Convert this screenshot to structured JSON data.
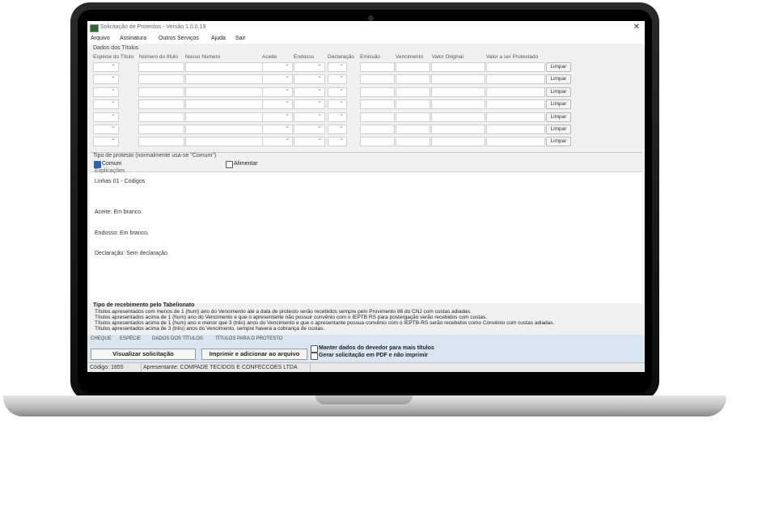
{
  "window": {
    "title": "Solicitação de Protestos - Versão 1.0.0.19"
  },
  "menu": [
    "Arquivo",
    "Assinatura",
    "Outros Serviços",
    "Ajuda",
    "Sair"
  ],
  "titles_section": {
    "label": "Dados dos Títulos",
    "columns": [
      "Espécie do Título",
      "Número do título",
      "Nosso Número",
      "Aceite",
      "Endosso",
      "Declaração",
      "Emissão",
      "Vencimento",
      "Valor Original",
      "Valor a ser Protestado"
    ],
    "row_button": "Limpar",
    "row_count": 7
  },
  "protest_type": {
    "label": "Tipo de protesto (normalmente usa-se \"Comum\")",
    "option_comum": "Comum",
    "option_alimentar": "Alimentar"
  },
  "explanation": {
    "label": "Explicações",
    "lines": [
      "Linhas 01 - Códigos",
      "Aceite: Em branco.",
      "Endosso: Em branco.",
      "Declaração: Sem declaração."
    ]
  },
  "receipt": {
    "label": "Tipo de recebimento pelo Tabelionato",
    "lines": [
      "Títulos apresentados com menos de 1 (hum) ano do Vencimento até a data de protesto serão recebidos sempre pelo Provimento 86 do CNJ com custas adiadas.",
      "Títulos apresentados acima de 1 (hum) ano do Vencimento e que o apresentante não possuir convênio com o IEPTB RS para postergação serão recebidos com custas.",
      "Títulos apresentados acima de 1 (hum) ano e menor que 3 (três) anos do Vencimento e que o apresentante possua convênio com o IEPTB-RS serão recebidos como Convênio com custas adiadas.",
      "Títulos apresentados acima de 3 (três) anos do Vencimento, sempre haverá a cobrança de custas."
    ]
  },
  "tabs": [
    "CHEQUE",
    "ESPÉCIE",
    "DADOS DOS TÍTULOS",
    "TÍTULOS PARA O PROTESTO"
  ],
  "actions": {
    "view_button": "Visualizar solicitação",
    "print_button": "Imprimir e adicionar ao arquivo",
    "keep_debtor": "Manter dados do devedor para mais títulos",
    "pdf_option": "Gerar solicitação em PDF e não imprimir"
  },
  "status": {
    "code": "Código: 1855",
    "presenter": "Apresentante: COMPADE TECIDOS E CONFECCOES LTDA"
  }
}
